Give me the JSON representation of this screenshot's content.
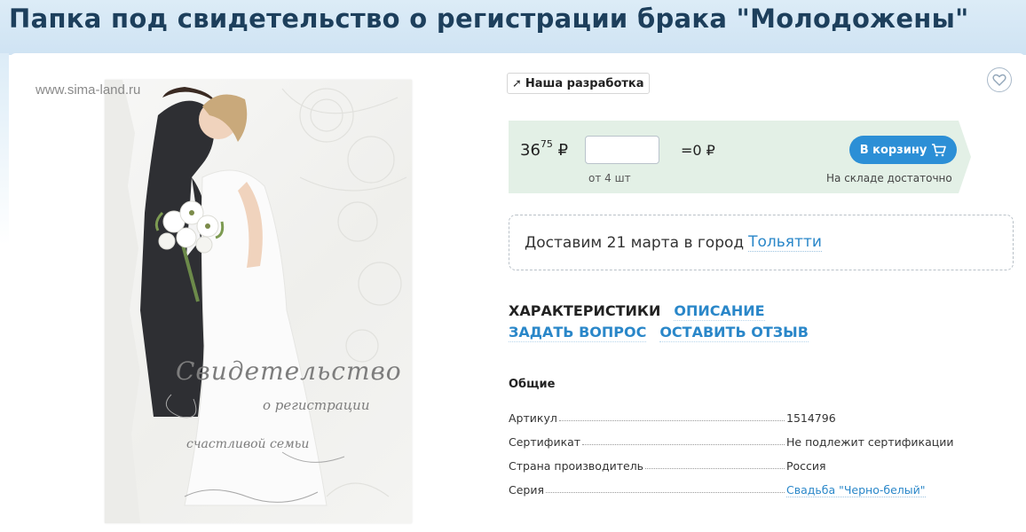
{
  "product": {
    "title": "Папка под свидетельство о регистрации брака \"Молодожены\""
  },
  "image": {
    "watermark": "www.sima-land.ru",
    "script_line_1": "Свидетельство",
    "script_line_2": "о регистрации",
    "script_line_3": "счастливой семьи"
  },
  "badge": {
    "label": "Наша разработка",
    "icon": "arrow-icon"
  },
  "favorite": {
    "icon": "heart-icon"
  },
  "buy": {
    "price_rub": "36",
    "price_kop": "75",
    "currency": "₽",
    "quantity_value": "",
    "total": "=0 ₽",
    "min_note": "от 4 шт",
    "cart_label": "В корзину",
    "cart_icon": "cart-icon",
    "stock_note": "На складе достаточно",
    "accent_color": "#2c8fd6",
    "panel_color": "#e3f0e6"
  },
  "delivery": {
    "text": "Доставим 21 марта в город",
    "city": "Тольятти"
  },
  "tabs": [
    {
      "label": "ХАРАКТЕРИСТИКИ",
      "active": true
    },
    {
      "label": "ОПИСАНИЕ",
      "active": false
    },
    {
      "label": "ЗАДАТЬ ВОПРОС",
      "active": false
    },
    {
      "label": "ОСТАВИТЬ ОТЗЫВ",
      "active": false
    }
  ],
  "specs": {
    "section_title": "Общие",
    "rows": [
      {
        "label": "Артикул",
        "value": "1514796"
      },
      {
        "label": "Сертификат",
        "value": "Не подлежит сертификации"
      },
      {
        "label": "Страна производитель",
        "value": "Россия"
      },
      {
        "label": "Серия",
        "value": "Свадьба \"Черно-белый\"",
        "link": true
      }
    ]
  }
}
